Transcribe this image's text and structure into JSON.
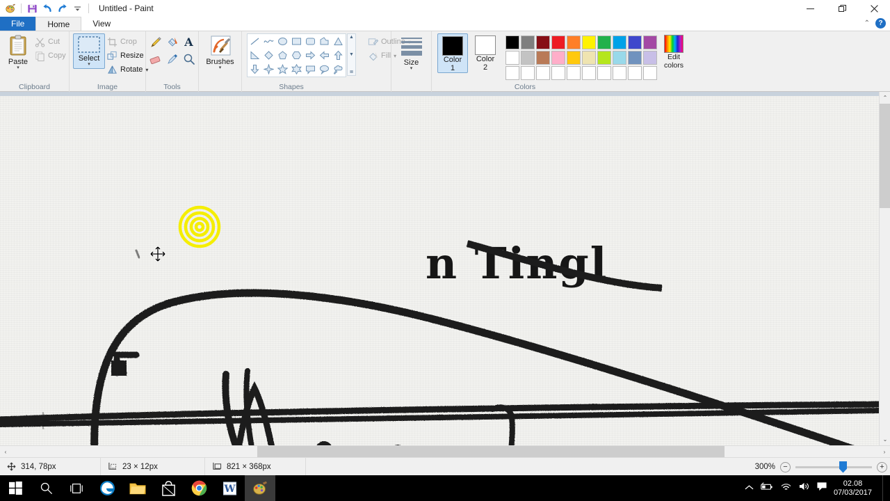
{
  "window": {
    "title": "Untitled - Paint",
    "quick_access": [
      "paint-app-icon",
      "save-icon",
      "undo-icon",
      "redo-icon",
      "customize-qat-icon"
    ],
    "controls": {
      "minimize": "—",
      "maximize": "❐",
      "close": "✕"
    },
    "ribbon_collapse": "⌃",
    "help": "?"
  },
  "tabs": [
    {
      "label": "File",
      "state": "file"
    },
    {
      "label": "Home",
      "state": "active"
    },
    {
      "label": "View",
      "state": "normal"
    }
  ],
  "ribbon": {
    "groups": [
      {
        "name": "Clipboard",
        "label": "Clipboard",
        "paste": {
          "label": "Paste",
          "dropdown": "▾",
          "icon": "clipboard-icon"
        },
        "items": [
          {
            "label": "Cut",
            "icon": "scissors-icon",
            "disabled": true
          },
          {
            "label": "Copy",
            "icon": "copy-icon",
            "disabled": true
          }
        ]
      },
      {
        "name": "Image",
        "label": "Image",
        "select": {
          "label": "Select",
          "dropdown": "▾",
          "icon": "selection-marquee-icon",
          "selected": true
        },
        "items": [
          {
            "label": "Crop",
            "icon": "crop-icon",
            "disabled": true
          },
          {
            "label": "Resize",
            "icon": "resize-icon",
            "disabled": false
          },
          {
            "label": "Rotate",
            "icon": "rotate-icon",
            "disabled": false,
            "dropdown": "▾"
          }
        ]
      },
      {
        "name": "Tools",
        "label": "Tools",
        "tools": [
          "pencil-icon",
          "fill-bucket-icon",
          "text-tool-icon",
          "eraser-icon",
          "color-picker-icon",
          "magnifier-icon"
        ]
      },
      {
        "name": "Brushes",
        "label": "",
        "brushes": {
          "label": "Brushes",
          "dropdown": "▾",
          "icon": "brushes-icon"
        }
      },
      {
        "name": "Shapes",
        "label": "Shapes",
        "shapes": [
          "line-shape",
          "curve-shape",
          "oval-shape",
          "rectangle-shape",
          "rounded-rectangle-shape",
          "polygon-shape",
          "triangle-shape",
          "right-triangle-shape",
          "diamond-shape",
          "pentagon-shape",
          "hexagon-shape",
          "right-arrow-shape",
          "left-arrow-shape",
          "up-arrow-shape",
          "down-arrow-shape",
          "four-point-star-shape",
          "five-point-star-shape",
          "six-point-star-shape",
          "rounded-callout-shape",
          "oval-callout-shape",
          "cloud-callout-shape"
        ],
        "scroll": {
          "up": "▲",
          "down": "▼",
          "more": "≣"
        },
        "outline": {
          "label": "Outline",
          "dropdown": "▾",
          "icon": "outline-icon",
          "disabled": true
        },
        "fill": {
          "label": "Fill",
          "dropdown": "▾",
          "icon": "fill-icon",
          "disabled": true
        }
      },
      {
        "name": "Size",
        "label": "",
        "size": {
          "label": "Size",
          "dropdown": "▾",
          "icon": "size-lines-icon"
        }
      },
      {
        "name": "Colors",
        "label": "Colors",
        "color1": {
          "label_line1": "Color",
          "label_line2": "1",
          "value": "#000000",
          "selected": true
        },
        "color2": {
          "label_line1": "Color",
          "label_line2": "2",
          "value": "#ffffff",
          "selected": false
        },
        "palette_row1": [
          "#000000",
          "#7f7f7f",
          "#870f16",
          "#ed1c24",
          "#ff7f27",
          "#fff200",
          "#22b14c",
          "#00a2e8",
          "#3f48cc",
          "#a349a4"
        ],
        "palette_row2": [
          "#ffffff",
          "#c3c3c3",
          "#b97a57",
          "#ffaec9",
          "#ffc90e",
          "#efe4b0",
          "#b5e61d",
          "#99d9ea",
          "#7092be",
          "#c8bfe7"
        ],
        "palette_row3": [
          "#ffffff",
          "#ffffff",
          "#ffffff",
          "#ffffff",
          "#ffffff",
          "#ffffff",
          "#ffffff",
          "#ffffff",
          "#ffffff",
          "#ffffff"
        ],
        "edit_colors": {
          "label_line1": "Edit",
          "label_line2": "colors",
          "icon": "rainbow-palette-icon"
        }
      }
    ]
  },
  "canvas": {
    "document_text": "n Tingl",
    "cursor": "move-cursor",
    "click_highlight": "yellow-click-ring",
    "highlight_color": "#f5ee00",
    "paper_color": "#f2f2ef",
    "ink_color": "#1d1d1d"
  },
  "scrollbars": {
    "vertical": {
      "up": "⌃",
      "down": "⌄"
    },
    "horizontal": {
      "left": "‹",
      "right": "›"
    }
  },
  "statusbar": {
    "cursor_position": "314, 78px",
    "cursor_position_icon": "crosshair-position-icon",
    "selection_size": "23 × 12px",
    "selection_size_icon": "selection-size-icon",
    "image_size": "821 × 368px",
    "image_size_icon": "image-size-icon",
    "zoom_level": "300%",
    "zoom_out": "−",
    "zoom_in": "+"
  },
  "taskbar": {
    "items": [
      {
        "name": "start-button",
        "icon": "windows-logo-icon"
      },
      {
        "name": "search-button",
        "icon": "search-icon"
      },
      {
        "name": "task-view-button",
        "icon": "task-view-icon"
      },
      {
        "name": "edge-button",
        "icon": "edge-browser-icon"
      },
      {
        "name": "file-explorer-button",
        "icon": "folder-icon"
      },
      {
        "name": "store-button",
        "icon": "microsoft-store-icon"
      },
      {
        "name": "chrome-button",
        "icon": "chrome-browser-icon"
      },
      {
        "name": "word-button",
        "icon": "word-icon"
      },
      {
        "name": "paint-button",
        "icon": "paint-icon",
        "active": true
      }
    ],
    "tray": [
      "show-hidden-icons",
      "battery-icon",
      "wifi-icon",
      "volume-icon",
      "action-center-icon"
    ],
    "clock_time": "02.08",
    "clock_date": "07/03/2017"
  }
}
